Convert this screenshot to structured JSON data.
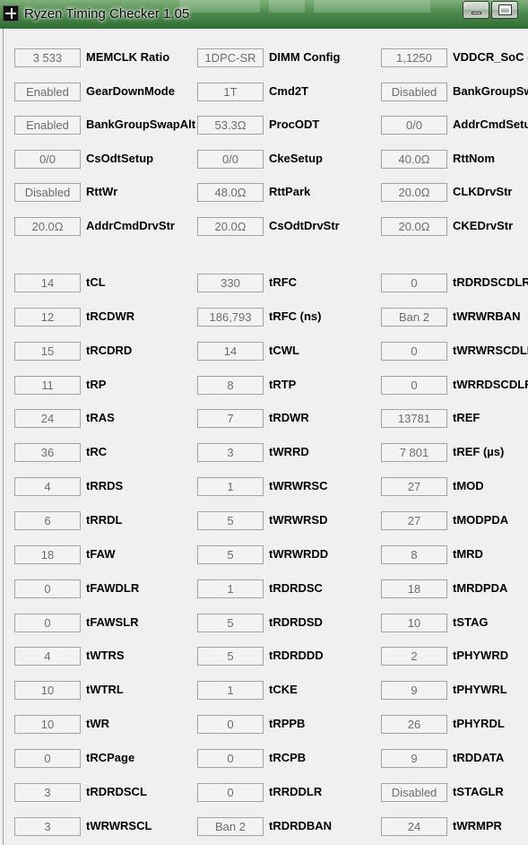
{
  "window": {
    "title": "Ryzen Timing Checker 1.05"
  },
  "icons": {
    "app": "app-cross-icon",
    "minimize": "minimize-icon",
    "maximize": "maximize-icon"
  },
  "config": [
    [
      {
        "value": "3 533",
        "label": "MEMCLK Ratio"
      },
      {
        "value": "1DPC-SR",
        "label": "DIMM Config"
      },
      {
        "value": "1,1250",
        "label": "VDDCR_SoC (V)"
      }
    ],
    [
      {
        "value": "Enabled",
        "label": "GearDownMode"
      },
      {
        "value": "1T",
        "label": "Cmd2T"
      },
      {
        "value": "Disabled",
        "label": "BankGroupSwap"
      }
    ],
    [
      {
        "value": "Enabled",
        "label": "BankGroupSwapAlt"
      },
      {
        "value": "53.3Ω",
        "label": "ProcODT"
      },
      {
        "value": "0/0",
        "label": "AddrCmdSetup"
      }
    ],
    [
      {
        "value": "0/0",
        "label": "CsOdtSetup"
      },
      {
        "value": "0/0",
        "label": "CkeSetup"
      },
      {
        "value": "40.0Ω",
        "label": "RttNom"
      }
    ],
    [
      {
        "value": "Disabled",
        "label": "RttWr"
      },
      {
        "value": "48.0Ω",
        "label": "RttPark"
      },
      {
        "value": "20.0Ω",
        "label": "CLKDrvStr"
      }
    ],
    [
      {
        "value": "20.0Ω",
        "label": "AddrCmdDrvStr"
      },
      {
        "value": "20.0Ω",
        "label": "CsOdtDrvStr"
      },
      {
        "value": "20.0Ω",
        "label": "CKEDrvStr"
      }
    ]
  ],
  "timings": [
    [
      {
        "value": "14",
        "label": "tCL"
      },
      {
        "value": "330",
        "label": "tRFC"
      },
      {
        "value": "0",
        "label": "tRDRDSCDLR"
      }
    ],
    [
      {
        "value": "12",
        "label": "tRCDWR"
      },
      {
        "value": "186,793",
        "label": "tRFC (ns)"
      },
      {
        "value": "Ban 2",
        "label": "tWRWRBAN"
      }
    ],
    [
      {
        "value": "15",
        "label": "tRCDRD"
      },
      {
        "value": "14",
        "label": "tCWL"
      },
      {
        "value": "0",
        "label": "tWRWRSCDLR"
      }
    ],
    [
      {
        "value": "11",
        "label": "tRP"
      },
      {
        "value": "8",
        "label": "tRTP"
      },
      {
        "value": "0",
        "label": "tWRRDSCDLR"
      }
    ],
    [
      {
        "value": "24",
        "label": "tRAS"
      },
      {
        "value": "7",
        "label": "tRDWR"
      },
      {
        "value": "13781",
        "label": "tREF"
      }
    ],
    [
      {
        "value": "36",
        "label": "tRC"
      },
      {
        "value": "3",
        "label": "tWRRD"
      },
      {
        "value": "7 801",
        "label": "tREF (µs)"
      }
    ],
    [
      {
        "value": "4",
        "label": "tRRDS"
      },
      {
        "value": "1",
        "label": "tWRWRSC"
      },
      {
        "value": "27",
        "label": "tMOD"
      }
    ],
    [
      {
        "value": "6",
        "label": "tRRDL"
      },
      {
        "value": "5",
        "label": "tWRWRSD"
      },
      {
        "value": "27",
        "label": "tMODPDA"
      }
    ],
    [
      {
        "value": "18",
        "label": "tFAW"
      },
      {
        "value": "5",
        "label": "tWRWRDD"
      },
      {
        "value": "8",
        "label": "tMRD"
      }
    ],
    [
      {
        "value": "0",
        "label": "tFAWDLR"
      },
      {
        "value": "1",
        "label": "tRDRDSC"
      },
      {
        "value": "18",
        "label": "tMRDPDA"
      }
    ],
    [
      {
        "value": "0",
        "label": "tFAWSLR"
      },
      {
        "value": "5",
        "label": "tRDRDSD"
      },
      {
        "value": "10",
        "label": "tSTAG"
      }
    ],
    [
      {
        "value": "4",
        "label": "tWTRS"
      },
      {
        "value": "5",
        "label": "tRDRDDD"
      },
      {
        "value": "2",
        "label": "tPHYWRD"
      }
    ],
    [
      {
        "value": "10",
        "label": "tWTRL"
      },
      {
        "value": "1",
        "label": "tCKE"
      },
      {
        "value": "9",
        "label": "tPHYWRL"
      }
    ],
    [
      {
        "value": "10",
        "label": "tWR"
      },
      {
        "value": "0",
        "label": "tRPPB"
      },
      {
        "value": "26",
        "label": "tPHYRDL"
      }
    ],
    [
      {
        "value": "0",
        "label": "tRCPage"
      },
      {
        "value": "0",
        "label": "tRCPB"
      },
      {
        "value": "9",
        "label": "tRDDATA"
      }
    ],
    [
      {
        "value": "3",
        "label": "tRDRDSCL"
      },
      {
        "value": "0",
        "label": "tRRDDLR"
      },
      {
        "value": "Disabled",
        "label": "tSTAGLR"
      }
    ],
    [
      {
        "value": "3",
        "label": "tWRWRSCL"
      },
      {
        "value": "Ban 2",
        "label": "tRDRDBAN"
      },
      {
        "value": "24",
        "label": "tWRMPR"
      }
    ]
  ]
}
